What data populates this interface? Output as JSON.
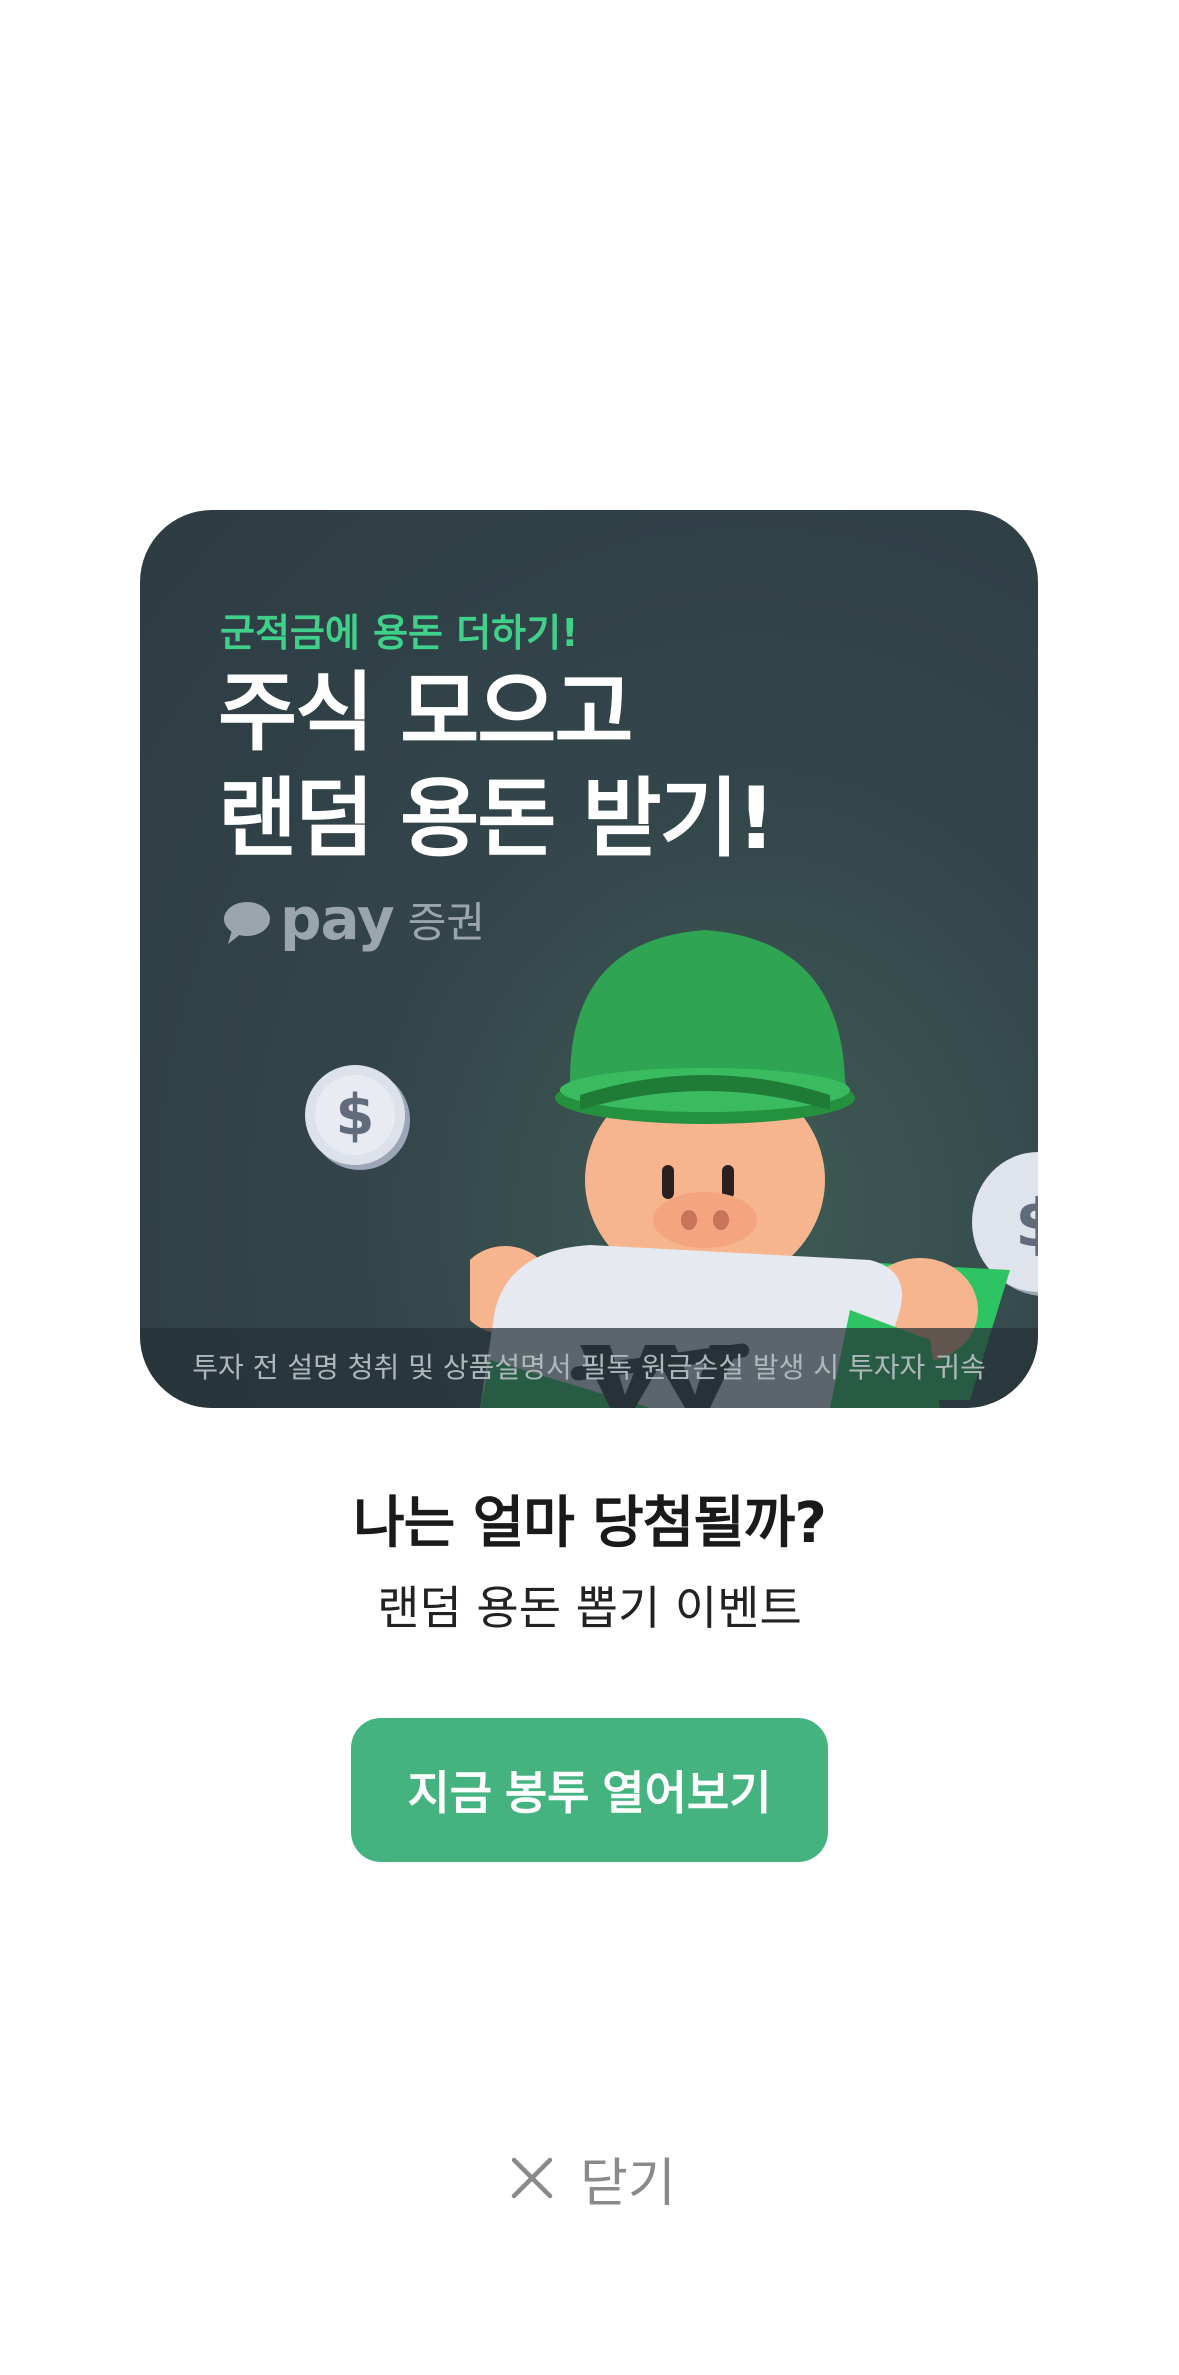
{
  "banner": {
    "subtitle": "군적금에 용돈 더하기!",
    "title_line1": "주식 모으고",
    "title_line2": "랜덤 용돈 받기!",
    "brand_pay": "pay",
    "brand_sec": "증권",
    "disclaimer": "투자 전 설명 청취 및 상품설명서 필독 원금손실 발생 시 투자자 귀속",
    "coin_symbol": "$",
    "accent_color": "#3fd08a",
    "background_color": "#2e3b43"
  },
  "content": {
    "headline": "나는 얼마 당첨될까?",
    "subheadline": "랜덤 용돈 뽑기 이벤트"
  },
  "cta": {
    "label": "지금 봉투 열어보기",
    "color": "#44b37f"
  },
  "close": {
    "label": "닫기",
    "icon": "close-icon"
  }
}
